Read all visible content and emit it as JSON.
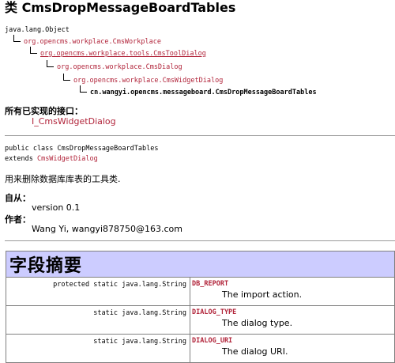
{
  "class_title": "类 CmsDropMessageBoardTables",
  "hierarchy": [
    {
      "text": "java.lang.Object",
      "link": false
    },
    {
      "text": "org.opencms.workplace.CmsWorkplace",
      "link": true
    },
    {
      "text": "org.opencms.workplace.tools.CmsToolDialog",
      "link": true
    },
    {
      "text": "org.opencms.workplace.CmsDialog",
      "link": true
    },
    {
      "text": "org.opencms.workplace.CmsWidgetDialog",
      "link": true
    },
    {
      "text": "cn.wangyi.opencms.messageboard.CmsDropMessageBoardTables",
      "link": false
    }
  ],
  "interfaces_label": "所有已实现的接口：",
  "interfaces_value": "I_CmsWidgetDialog",
  "declaration_line1": "public class CmsDropMessageBoardTables",
  "declaration_extends": "extends ",
  "declaration_parent": "CmsWidgetDialog",
  "description": "用来删除数据库库表的工具类.",
  "since_label": "自从：",
  "since_value": "version 0.1",
  "author_label": "作者：",
  "author_value": "Wang Yi, wangyi878750@163.com",
  "field_summary_title": "字段摘要",
  "fields": [
    {
      "modifier": "protected static java.lang.String",
      "name": "DB_REPORT",
      "desc": "The import action."
    },
    {
      "modifier": "static java.lang.String",
      "name": "DIALOG_TYPE",
      "desc": "The dialog type."
    },
    {
      "modifier": "static java.lang.String",
      "name": "DIALOG_URI",
      "desc": "The dialog URI."
    }
  ]
}
